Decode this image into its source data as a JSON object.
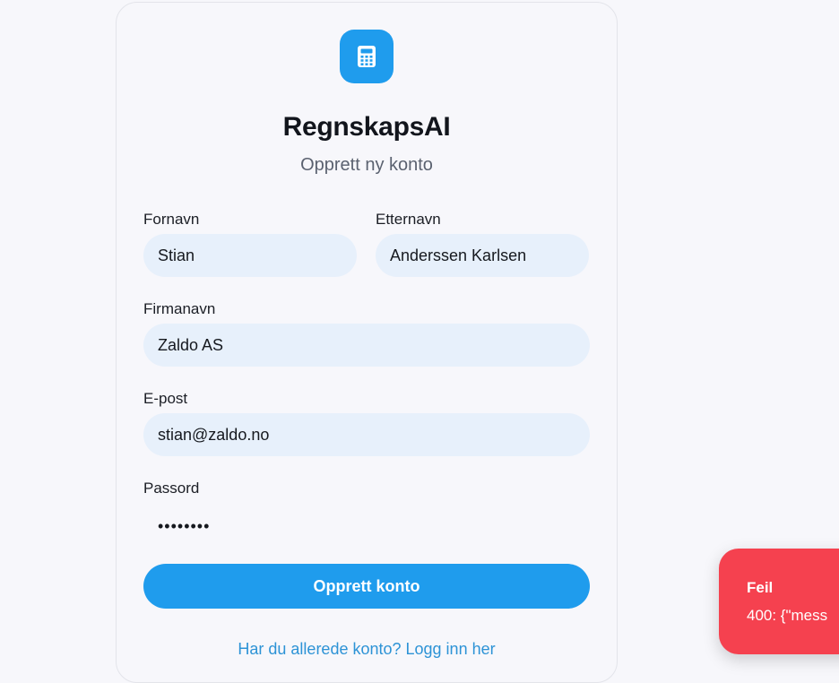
{
  "app": {
    "name": "RegnskapsAI",
    "subtitle": "Opprett ny konto",
    "brand_color": "#1f9ced",
    "logo_icon": "calculator-icon"
  },
  "form": {
    "first_name": {
      "label": "Fornavn",
      "value": "Stian"
    },
    "last_name": {
      "label": "Etternavn",
      "value": "Anderssen Karlsen"
    },
    "company": {
      "label": "Firmanavn",
      "value": "Zaldo AS"
    },
    "email": {
      "label": "E-post",
      "value": "stian@zaldo.no"
    },
    "password": {
      "label": "Passord",
      "masked_value": "••••••••"
    },
    "submit_label": "Opprett konto",
    "login_link": "Har du allerede konto? Logg inn her"
  },
  "toast": {
    "title": "Feil",
    "message": "400: {\"mess",
    "color": "#f5414f"
  }
}
